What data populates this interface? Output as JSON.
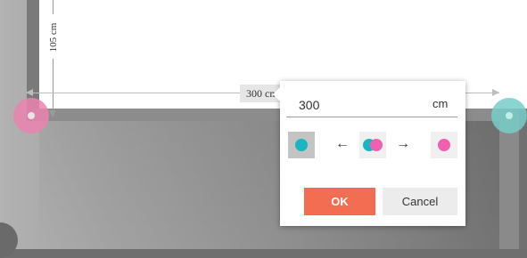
{
  "canvas": {
    "vertical_dimension": "105 cm",
    "horizontal_dimension": "300 cm"
  },
  "popup": {
    "length_value": "300",
    "unit": "cm",
    "direction_left": "←",
    "direction_right": "→",
    "ok_label": "OK",
    "cancel_label": "Cancel",
    "colors": {
      "teal": "#19b5c0",
      "pink": "#f060b0",
      "ok_button": "#f26d51"
    }
  }
}
